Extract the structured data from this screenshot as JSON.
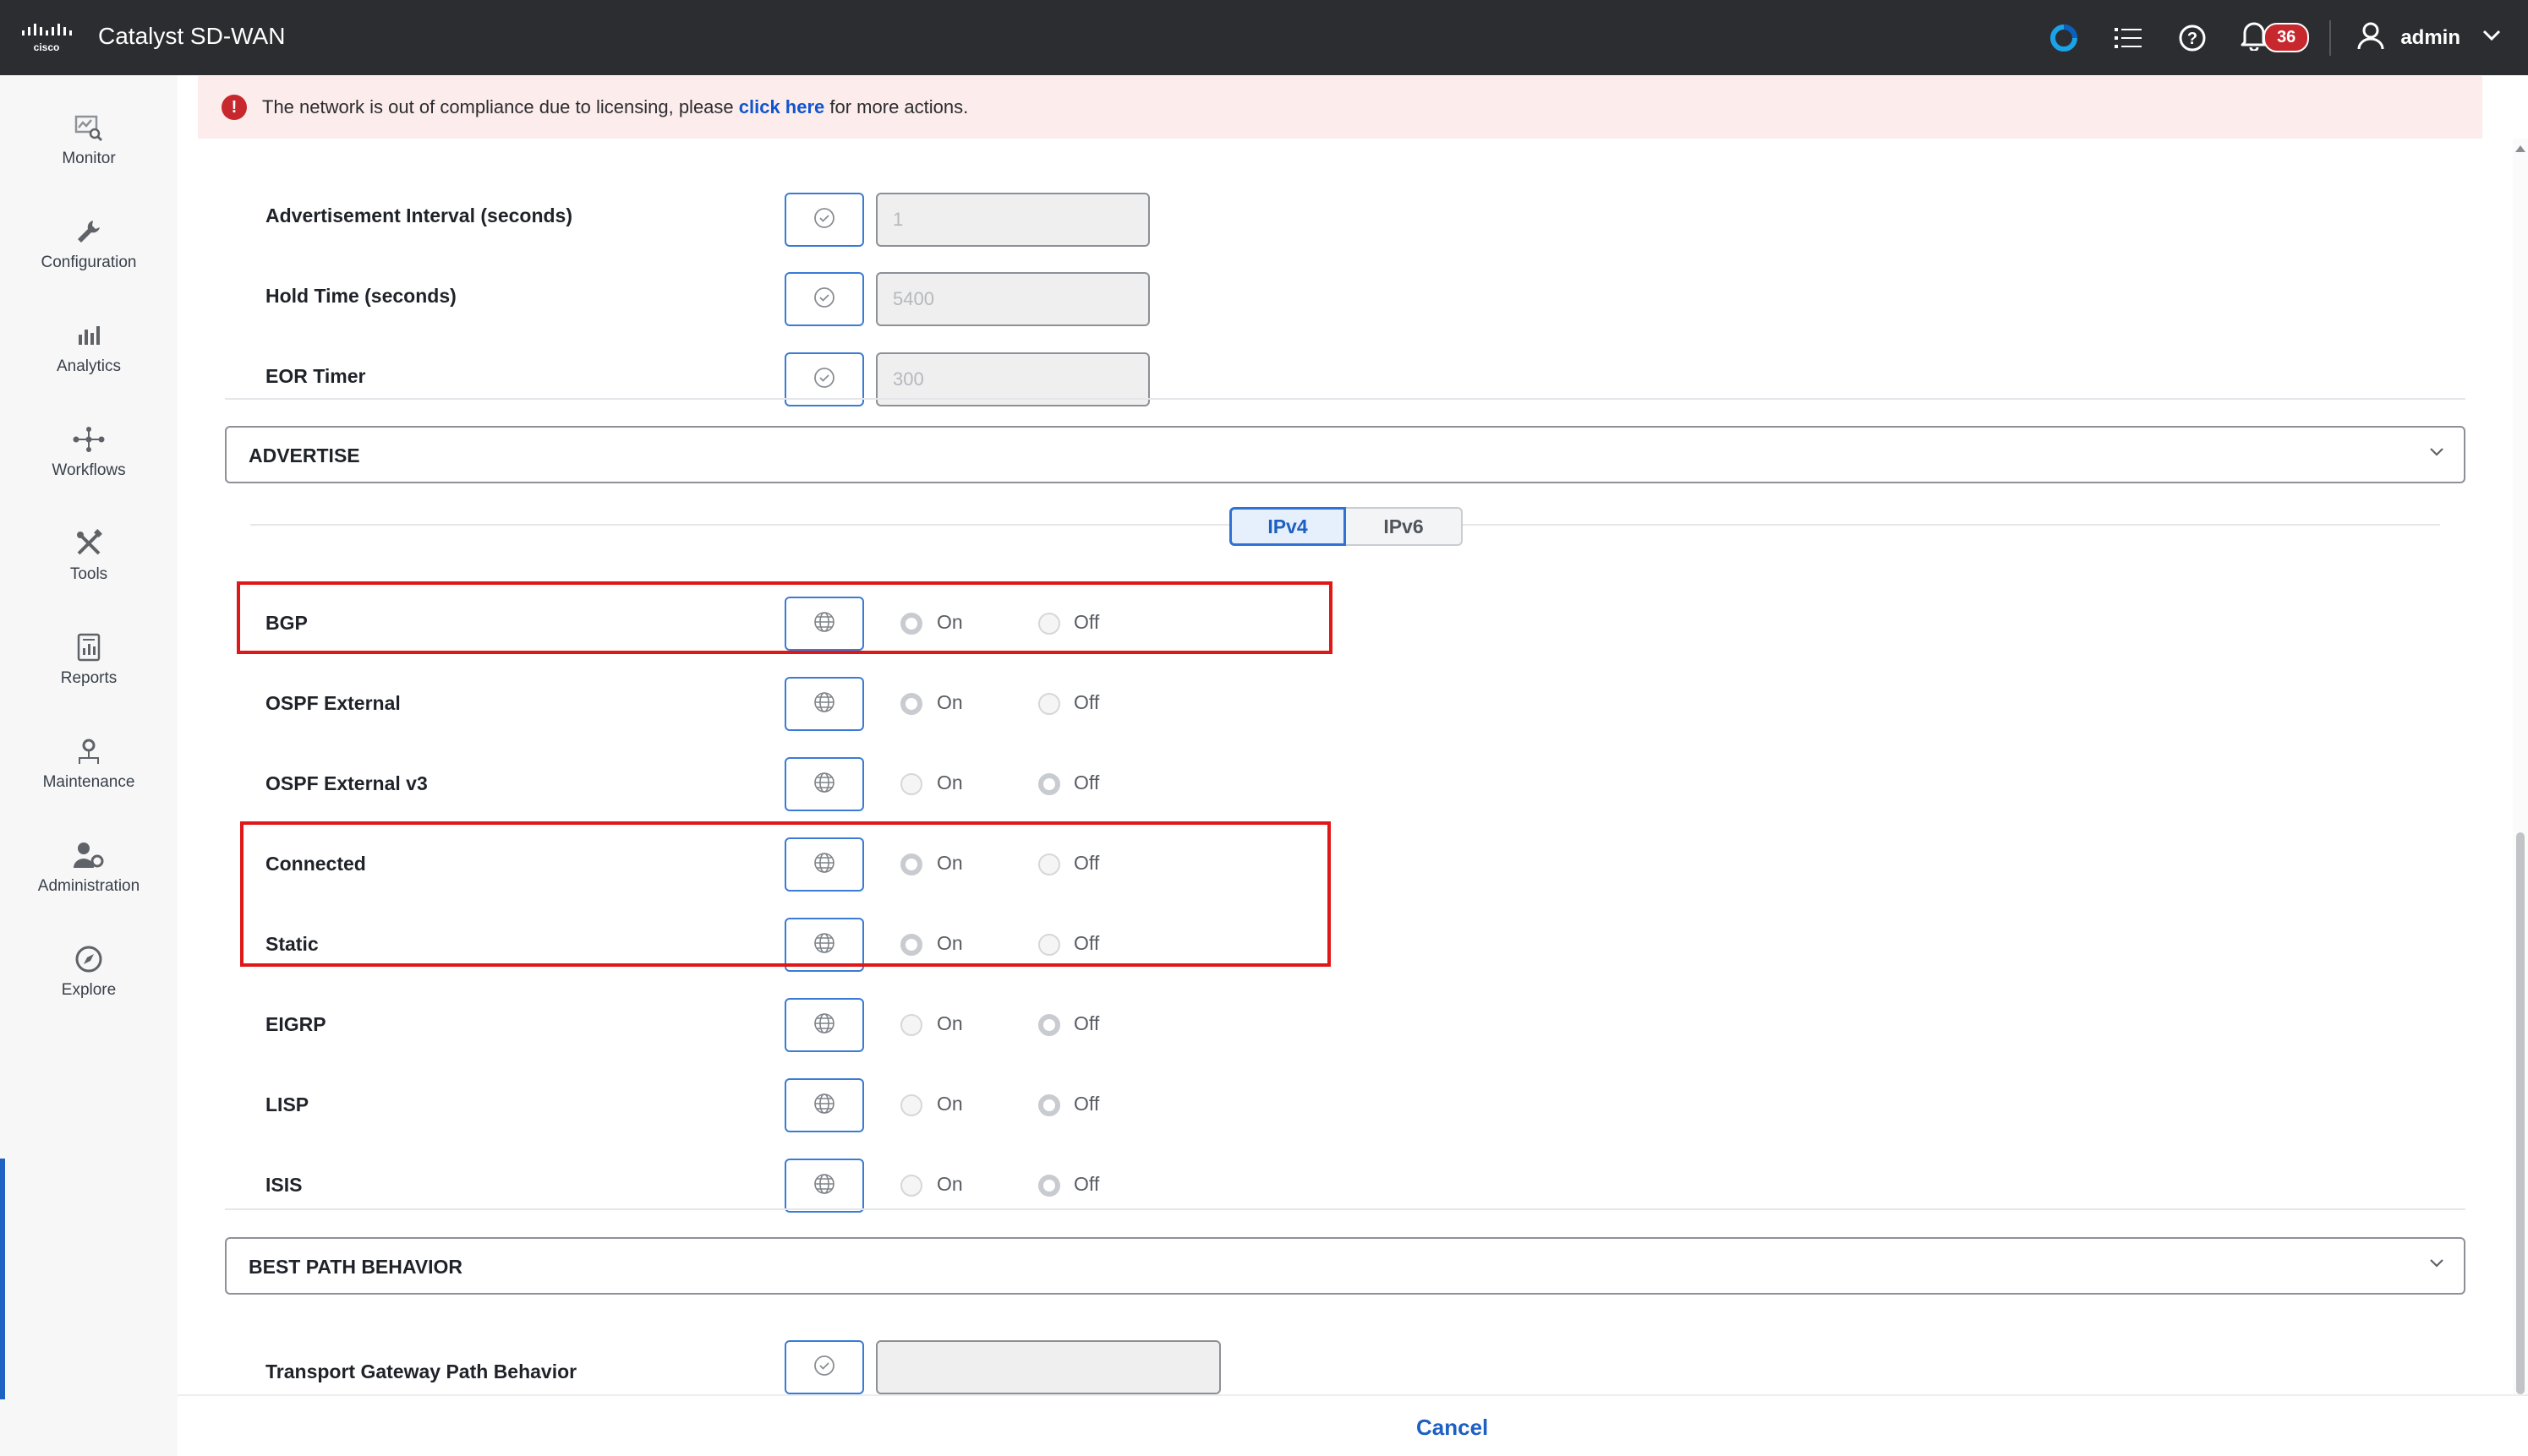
{
  "app": {
    "title": "Catalyst SD-WAN",
    "logo_text": "cisco"
  },
  "topbar": {
    "icons": [
      "brand-swirl-icon",
      "task-list-icon",
      "help-icon",
      "bell-icon"
    ],
    "notification_count": "36",
    "user_name": "admin"
  },
  "sidebar": {
    "items": [
      {
        "label": "Monitor",
        "icon": "monitor-icon"
      },
      {
        "label": "Configuration",
        "icon": "wrench-icon"
      },
      {
        "label": "Analytics",
        "icon": "bar-chart-icon"
      },
      {
        "label": "Workflows",
        "icon": "workflow-icon"
      },
      {
        "label": "Tools",
        "icon": "tools-icon"
      },
      {
        "label": "Reports",
        "icon": "report-icon"
      },
      {
        "label": "Maintenance",
        "icon": "maintenance-icon"
      },
      {
        "label": "Administration",
        "icon": "admin-icon"
      },
      {
        "label": "Explore",
        "icon": "compass-icon"
      }
    ]
  },
  "alert": {
    "text_before": "The network is out of compliance due to licensing, please ",
    "link": "click here",
    "text_after": " for more actions."
  },
  "timers": [
    {
      "label": "Advertisement Interval (seconds)",
      "value": "1"
    },
    {
      "label": "Hold Time (seconds)",
      "value": "5400"
    },
    {
      "label": "EOR Timer",
      "value": "300"
    }
  ],
  "advertise": {
    "title": "ADVERTISE",
    "tabs": [
      "IPv4",
      "IPv6"
    ],
    "active_tab": "IPv4",
    "on_label": "On",
    "off_label": "Off",
    "rows": [
      {
        "label": "BGP",
        "selected": "On"
      },
      {
        "label": "OSPF External",
        "selected": "On"
      },
      {
        "label": "OSPF External v3",
        "selected": "Off"
      },
      {
        "label": "Connected",
        "selected": "On"
      },
      {
        "label": "Static",
        "selected": "On"
      },
      {
        "label": "EIGRP",
        "selected": "Off"
      },
      {
        "label": "LISP",
        "selected": "Off"
      },
      {
        "label": "ISIS",
        "selected": "Off"
      }
    ]
  },
  "best_path": {
    "title": "BEST PATH BEHAVIOR",
    "rows": [
      {
        "label": "Transport Gateway Path Behavior",
        "value": ""
      }
    ]
  },
  "footer": {
    "cancel_label": "Cancel"
  },
  "colors": {
    "accent": "#1d5fc2",
    "highlight": "#e01717",
    "alert_bg": "#fcecec",
    "topbar": "#2b2d30"
  }
}
